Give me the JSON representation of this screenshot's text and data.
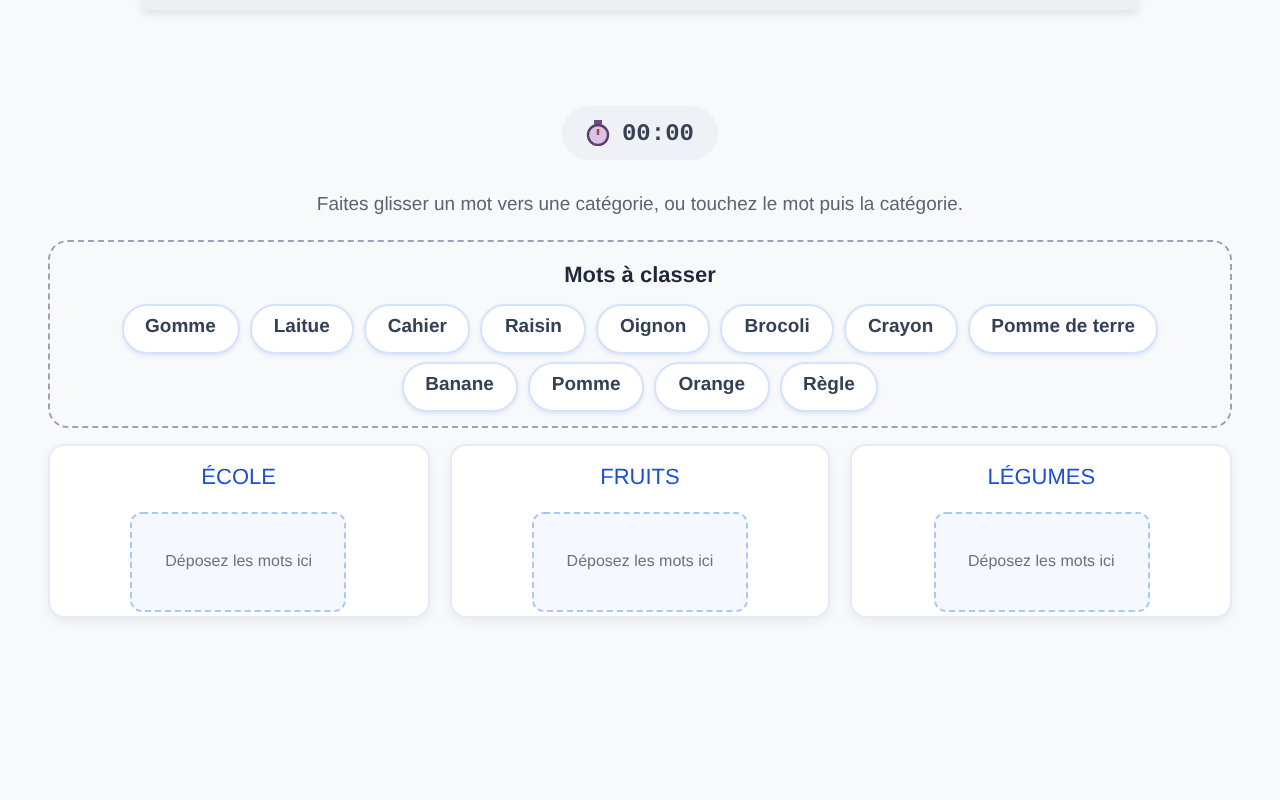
{
  "timer": {
    "time": "00:00"
  },
  "instruction": "Faites glisser un mot vers une catégorie, ou touchez le mot puis la catégorie.",
  "word_bank": {
    "title": "Mots à classer",
    "words": [
      "Gomme",
      "Laitue",
      "Cahier",
      "Raisin",
      "Oignon",
      "Brocoli",
      "Crayon",
      "Pomme de terre",
      "Banane",
      "Pomme",
      "Orange",
      "Règle"
    ]
  },
  "categories": [
    {
      "title": "ÉCOLE",
      "drop_hint": "Déposez les mots ici"
    },
    {
      "title": "FRUITS",
      "drop_hint": "Déposez les mots ici"
    },
    {
      "title": "LÉGUMES",
      "drop_hint": "Déposez les mots ici"
    }
  ]
}
